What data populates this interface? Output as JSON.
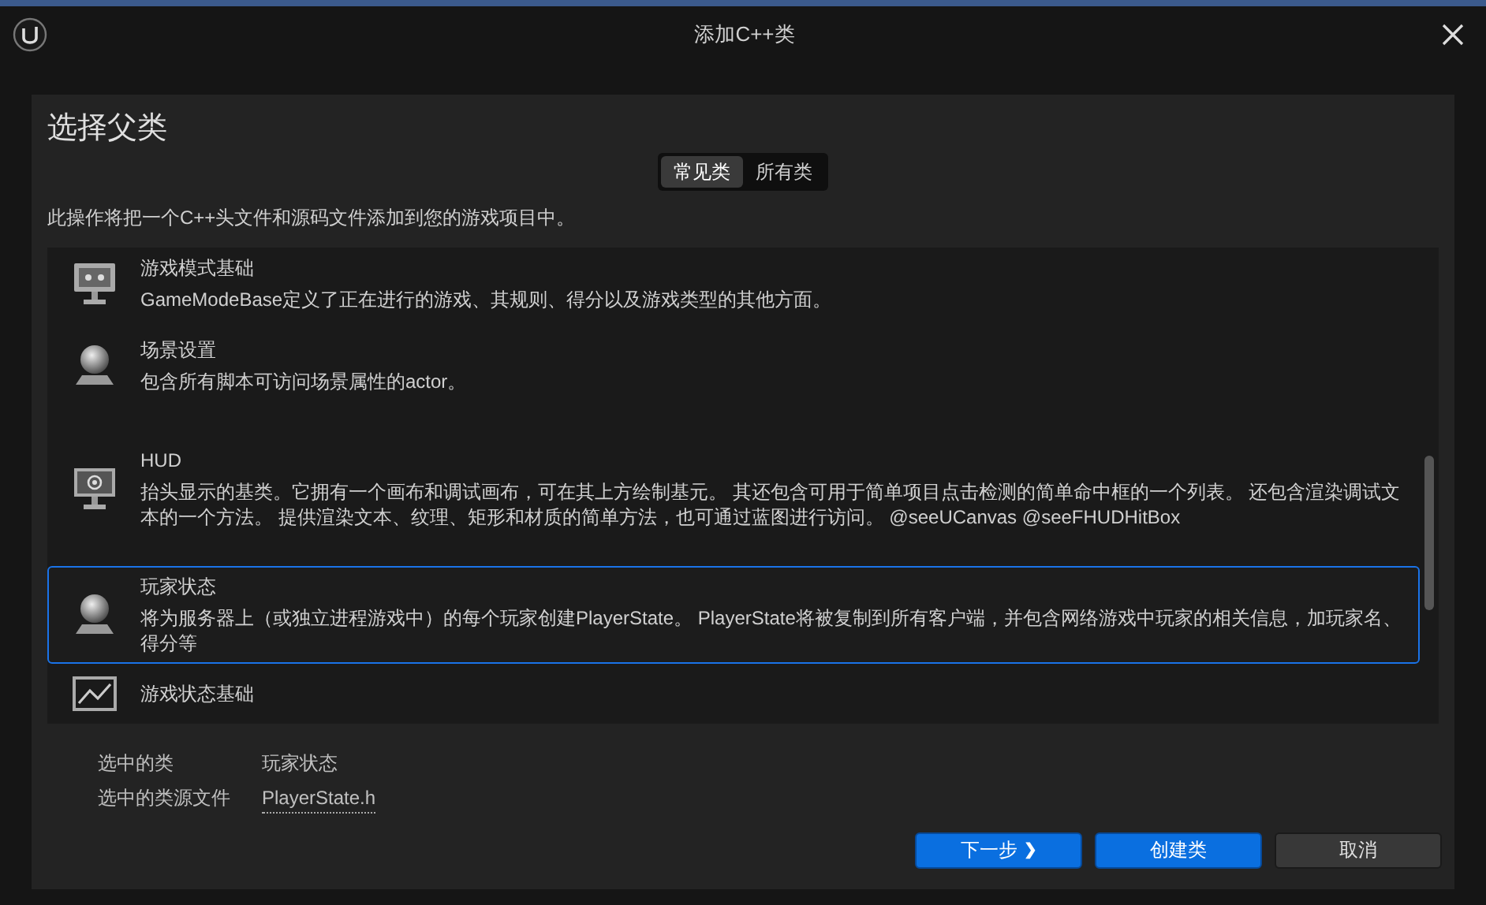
{
  "window": {
    "title": "添加C++类"
  },
  "heading": "选择父类",
  "tabs": [
    {
      "label": "常见类",
      "selected": true
    },
    {
      "label": "所有类",
      "selected": false
    }
  ],
  "intro": "此操作将把一个C++头文件和源码文件添加到您的游戏项目中。",
  "classes": [
    {
      "kind": "gamepad",
      "name": "游戏模式基础",
      "description": "GameModeBase定义了正在进行的游戏、其规则、得分以及游戏类型的其他方面。",
      "selected": false
    },
    {
      "kind": "sphere",
      "name": "场景设置",
      "description": "包含所有脚本可访问场景属性的actor。",
      "selected": false
    },
    {
      "kind": "target",
      "name": "HUD",
      "description": "抬头显示的基类。它拥有一个画布和调试画布，可在其上方绘制基元。 其还包含可用于简单项目点击检测的简单命中框的一个列表。 还包含渲染调试文本的一个方法。 提供渲染文本、纹理、矩形和材质的简单方法，也可通过蓝图进行访问。 @seeUCanvas @seeFHUDHitBox",
      "selected": false
    },
    {
      "kind": "sphere",
      "name": "玩家状态",
      "description": "将为服务器上（或独立进程游戏中）的每个玩家创建PlayerState。 PlayerState将被复制到所有客户端，并包含网络游戏中玩家的相关信息，加玩家名、得分等",
      "selected": true
    },
    {
      "kind": "chart",
      "name": "游戏状态基础",
      "selected": false
    }
  ],
  "summary": [
    {
      "label": "选中的类",
      "value": "玩家状态",
      "kind": "text"
    },
    {
      "label": "选中的类源文件",
      "value": "PlayerState.h",
      "kind": "link"
    }
  ],
  "buttons": [
    {
      "label": "下一步",
      "kind": "primary",
      "chevron": "❯"
    },
    {
      "label": "创建类",
      "kind": "primary"
    },
    {
      "label": "取消",
      "kind": "secondary"
    }
  ]
}
